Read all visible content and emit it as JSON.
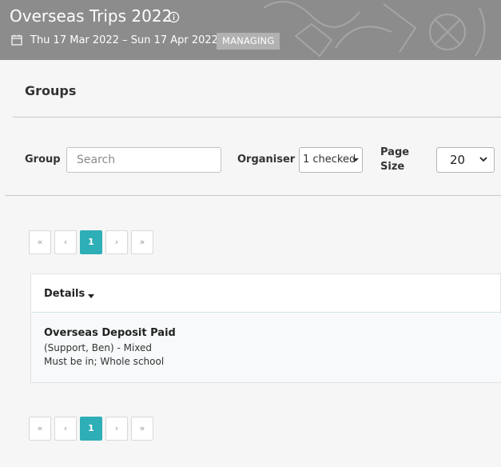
{
  "header": {
    "title": "Overseas Trips 2022",
    "date_range": "Thu 17 Mar 2022 – Sun 17 Apr 2022",
    "badge": "MANAGING",
    "icons": [
      "info-icon",
      "calendar-icon"
    ],
    "banner_color": "#8c8c8c"
  },
  "section": {
    "title": "Groups"
  },
  "filters": {
    "group_label": "Group",
    "search_placeholder": "Search",
    "search_value": "",
    "organiser_label": "Organiser",
    "organiser_value": "1 checked",
    "page_size_label_1": "Page",
    "page_size_label_2": "Size",
    "page_size_value": "20"
  },
  "pagination": {
    "first": "«",
    "prev": "‹",
    "current": "1",
    "next": "›",
    "last": "»",
    "accent": "#2eaeb7"
  },
  "table": {
    "header_label": "Details",
    "rows": [
      {
        "title": "Overseas Deposit Paid",
        "subtitle": "(Support, Ben) - Mixed",
        "detail": "Must be in; Whole school"
      }
    ]
  }
}
